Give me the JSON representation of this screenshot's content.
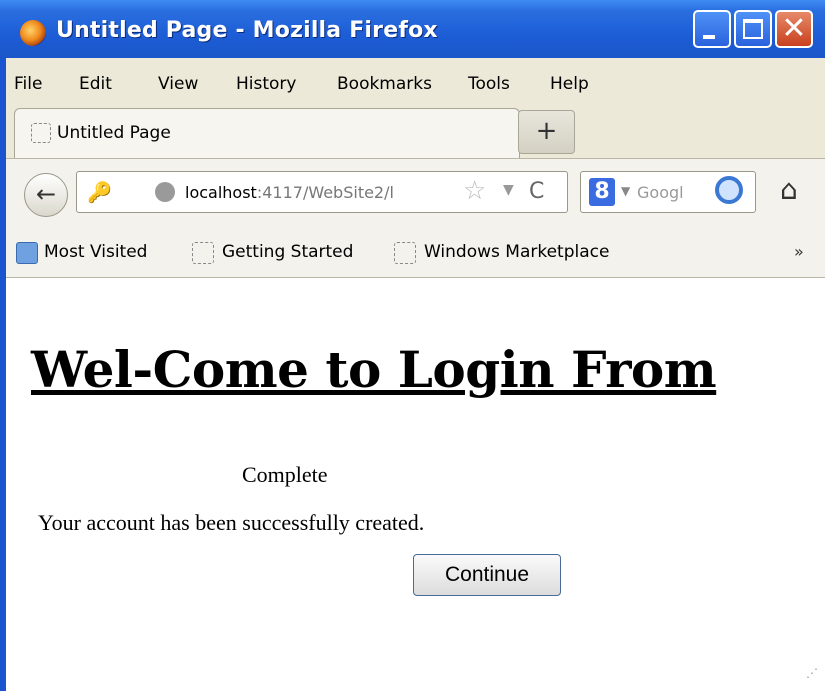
{
  "window": {
    "title": "Untitled Page - Mozilla Firefox",
    "close_glyph": "✕"
  },
  "menu": [
    "File",
    "Edit",
    "View",
    "History",
    "Bookmarks",
    "Tools",
    "Help"
  ],
  "tab": {
    "title": "Untitled Page",
    "new_tab_label": "+"
  },
  "nav": {
    "url_host": "localhost",
    "url_rest": ":4117/WebSite2/l",
    "search_placeholder": "Googl",
    "back_glyph": "←",
    "reload_glyph": "C",
    "star_glyph": "☆",
    "dropdown_glyph": "▼",
    "home_glyph": "⌂",
    "key_glyph": "🔑"
  },
  "bookmarks": {
    "items": [
      "Most Visited",
      "Getting Started",
      "Windows Marketplace"
    ],
    "overflow": "»"
  },
  "page": {
    "heading": "Wel-Come to Login From",
    "status": "Complete",
    "message": "Your account has been successfully created.",
    "continue_label": "Continue"
  }
}
